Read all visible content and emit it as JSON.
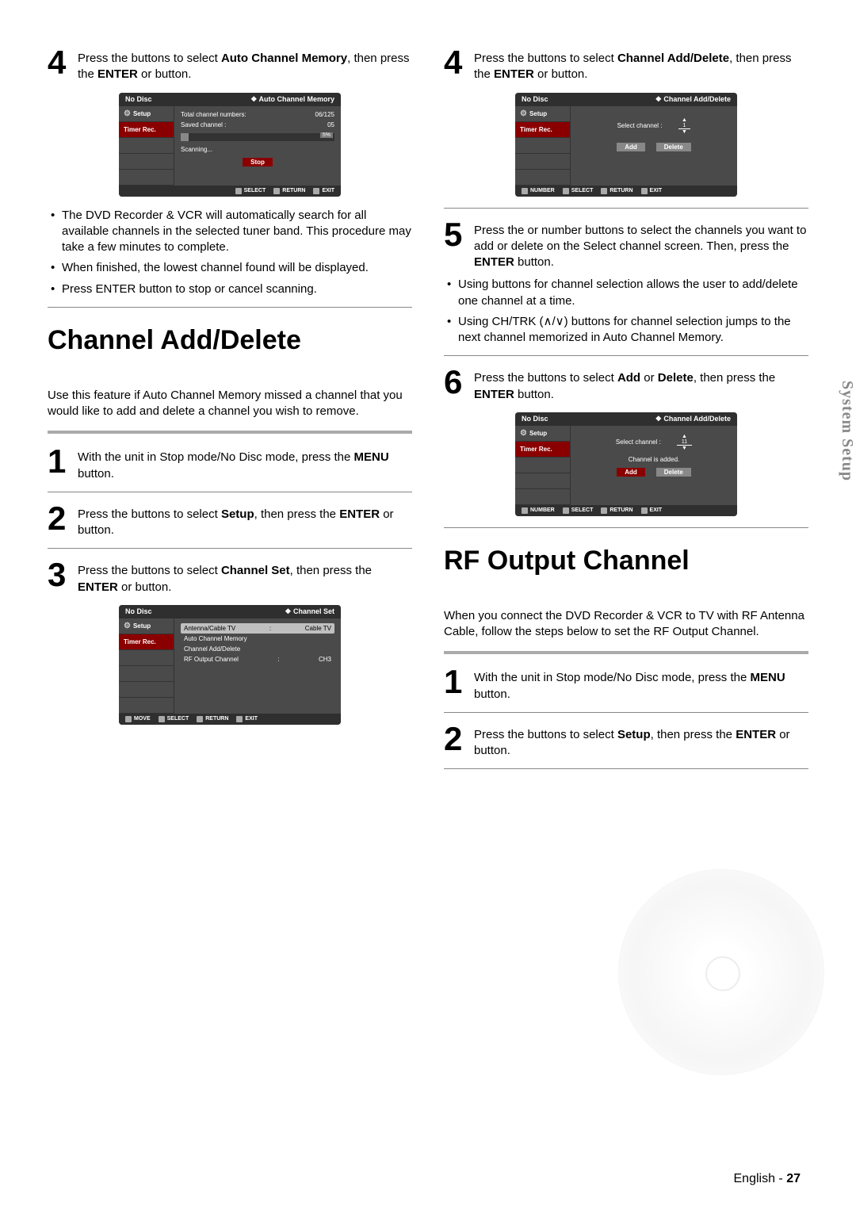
{
  "sideTab": "System Setup",
  "footer": {
    "lang": "English",
    "sep": " - ",
    "page": "27"
  },
  "left": {
    "step4": {
      "num": "4",
      "pre": "Press the ",
      "mid": " buttons to select ",
      "bold1": "Auto Channel Memory",
      "post1": ", then press the ",
      "bold2": "ENTER",
      "post2": " or ",
      "post3": " button."
    },
    "osd1": {
      "titleLeft": "No Disc",
      "titleRight": "❖  Auto Channel Memory",
      "side": {
        "setup": "Setup",
        "timer": "Timer Rec."
      },
      "line1a": "Total channel numbers:",
      "line1b": "06/125",
      "line2a": "Saved channel :",
      "line2b": "05",
      "progressLabel": "5%",
      "scanning": "Scanning...",
      "stop": "Stop",
      "foot": {
        "select": "SELECT",
        "return": "RETURN",
        "exit": "EXIT"
      }
    },
    "bullets": [
      "The DVD Recorder & VCR will automatically search for all available channels in the selected tuner band. This procedure may take a few minutes to complete.",
      "When finished, the lowest channel found will be displayed.",
      "Press ENTER button to stop or cancel scanning."
    ],
    "title1": "Channel Add/Delete",
    "intro": "Use this feature if Auto Channel Memory missed a channel that you would like to add and delete a channel you wish to remove.",
    "step1": {
      "num": "1",
      "text": "With the unit in Stop mode/No Disc mode, press the ",
      "bold": "MENU",
      "after": " button."
    },
    "step2": {
      "num": "2",
      "pre": "Press the ",
      "mid": " buttons to select ",
      "bold1": "Setup",
      "post1": ", then press the ",
      "bold2": "ENTER",
      "post2": " or ",
      "post3": " button."
    },
    "step3": {
      "num": "3",
      "pre": "Press the ",
      "mid": " buttons to select ",
      "bold1": "Channel Set",
      "post1": ", then press the ",
      "bold2": "ENTER",
      "post2": " or ",
      "post3": " button."
    },
    "osd2": {
      "titleLeft": "No Disc",
      "titleRight": "❖  Channel Set",
      "side": {
        "setup": "Setup",
        "timer": "Timer Rec."
      },
      "rows": [
        {
          "label": "Antenna/Cable TV",
          "sep": ":",
          "val": "Cable TV",
          "hl": true
        },
        {
          "label": "Auto Channel Memory",
          "sep": "",
          "val": "",
          "hl": false
        },
        {
          "label": "Channel Add/Delete",
          "sep": "",
          "val": "",
          "hl": false
        },
        {
          "label": "RF Output Channel",
          "sep": ":",
          "val": "CH3",
          "hl": false
        }
      ],
      "foot": {
        "move": "MOVE",
        "select": "SELECT",
        "return": "RETURN",
        "exit": "EXIT"
      }
    }
  },
  "right": {
    "step4": {
      "num": "4",
      "pre": "Press the ",
      "mid": " buttons to select ",
      "bold1": "Channel Add/Delete",
      "post1": ", then press the ",
      "bold2": "ENTER",
      "post2": " or ",
      "post3": " button."
    },
    "osd1": {
      "titleLeft": "No Disc",
      "titleRight": "❖  Channel Add/Delete",
      "side": {
        "setup": "Setup",
        "timer": "Timer Rec."
      },
      "selectLbl": "Select channel :",
      "selectVal": "1",
      "add": "Add",
      "del": "Delete",
      "foot": {
        "number": "NUMBER",
        "select": "SELECT",
        "return": "RETURN",
        "exit": "EXIT"
      }
    },
    "step5": {
      "num": "5",
      "pre": "Press the ",
      "mid1": " or number buttons to select the channels you want to add or delete on the Select channel screen. Then, press the ",
      "bold1": "ENTER",
      "post1": " button."
    },
    "bullets5": [
      "Using         buttons for channel selection allows the user to add/delete one channel at a time.",
      "Using CH/TRK (∧/∨) buttons for channel selection jumps to the next channel memorized in Auto Channel Memory."
    ],
    "step6": {
      "num": "6",
      "pre": "Press the ",
      "mid": " buttons to select ",
      "bold1": "Add",
      "or": " or ",
      "bold2": "Delete",
      "post1": ", then press the ",
      "bold3": "ENTER",
      "post2": " button."
    },
    "osd2": {
      "titleLeft": "No Disc",
      "titleRight": "❖  Channel Add/Delete",
      "side": {
        "setup": "Setup",
        "timer": "Timer Rec."
      },
      "selectLbl": "Select channel :",
      "selectVal": "11",
      "addedMsg": "Channel is added.",
      "add": "Add",
      "del": "Delete",
      "foot": {
        "number": "NUMBER",
        "select": "SELECT",
        "return": "RETURN",
        "exit": "EXIT"
      }
    },
    "title2": "RF Output Channel",
    "intro2": "When you connect the DVD Recorder & VCR to TV with RF Antenna Cable, follow the steps below to set the RF Output Channel.",
    "rstep1": {
      "num": "1",
      "text": "With the unit in Stop mode/No Disc mode, press the ",
      "bold": "MENU",
      "after": " button."
    },
    "rstep2": {
      "num": "2",
      "pre": "Press the ",
      "mid": " buttons to select ",
      "bold1": "Setup",
      "post1": ", then press the ",
      "bold2": "ENTER",
      "post2": " or ",
      "post3": " button."
    }
  }
}
